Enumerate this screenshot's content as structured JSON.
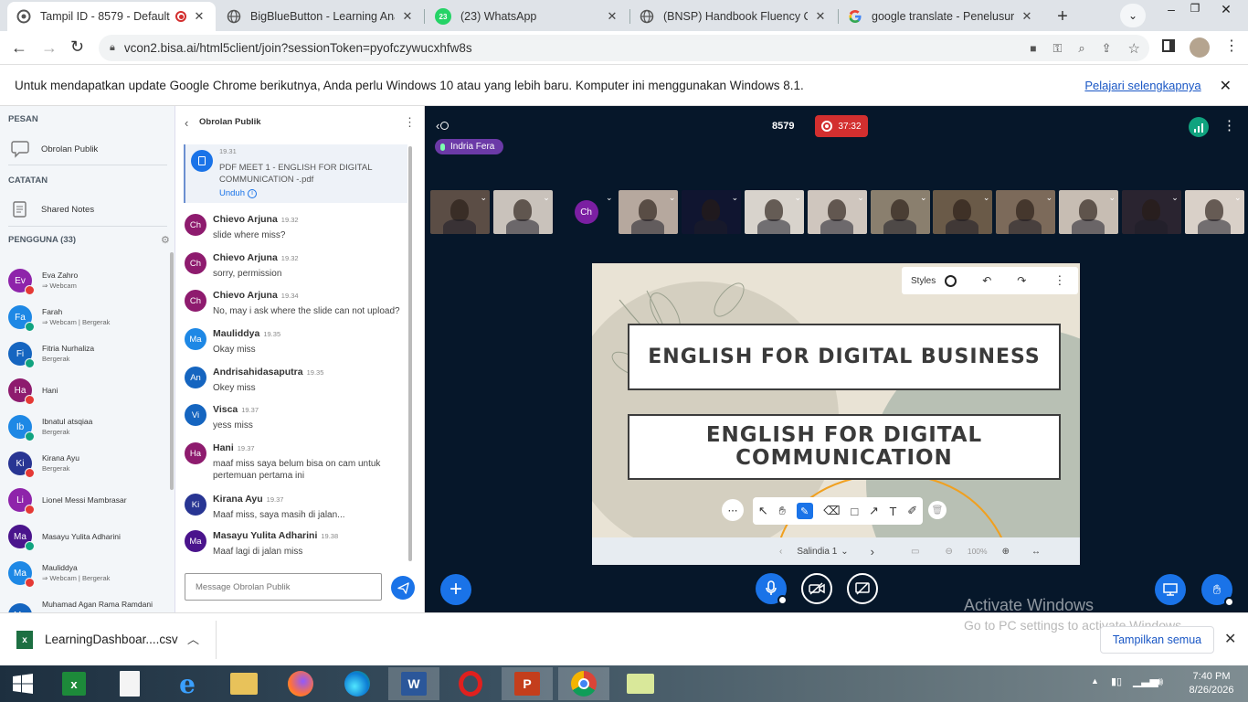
{
  "browser": {
    "tabs": [
      {
        "title": "Tampil ID - 8579 - Default",
        "active": true
      },
      {
        "title": "BigBlueButton - Learning Analy"
      },
      {
        "title": "(23) WhatsApp",
        "badge": "23"
      },
      {
        "title": "(BNSP) Handbook Fluency Clas"
      },
      {
        "title": "google translate - Penelusuran"
      }
    ],
    "url": "vcon2.bisa.ai/html5client/join?sessionToken=pyofczywucxhfw8s",
    "infobar": {
      "message": "Untuk mendapatkan update Google Chrome berikutnya, Anda perlu Windows 10 atau yang lebih baru. Komputer ini menggunakan Windows 8.1.",
      "link": "Pelajari selengkapnya"
    }
  },
  "sidebar": {
    "pesan_header": "PESAN",
    "public_chat": "Obrolan Publik",
    "catatan_header": "CATATAN",
    "shared_notes": "Shared Notes",
    "users_header": "PENGGUNA (33)",
    "users": [
      {
        "initials": "Ev",
        "name": "Eva Zahro",
        "sub": "⇒ Webcam",
        "color": "#8e24aa",
        "status": "red"
      },
      {
        "initials": "Fa",
        "name": "Farah",
        "sub": "⇒ Webcam | Bergerak",
        "color": "#1e88e5",
        "status": "green"
      },
      {
        "initials": "Fi",
        "name": "Fitria Nurhaliza",
        "sub": "Bergerak",
        "color": "#1565c0",
        "status": "green"
      },
      {
        "initials": "Ha",
        "name": "Hani",
        "sub": "",
        "color": "#8e1b6e",
        "status": "red"
      },
      {
        "initials": "Ib",
        "name": "Ibnatul atsqiaa",
        "sub": "Bergerak",
        "color": "#1e88e5",
        "status": "green"
      },
      {
        "initials": "Ki",
        "name": "Kirana Ayu",
        "sub": "Bergerak",
        "color": "#283593",
        "status": "red"
      },
      {
        "initials": "Li",
        "name": "Lionel Messi Mambrasar",
        "sub": "",
        "color": "#8e24aa",
        "status": "red"
      },
      {
        "initials": "Ma",
        "name": "Masayu Yulita Adharini",
        "sub": "",
        "color": "#4a148c",
        "status": "green"
      },
      {
        "initials": "Ma",
        "name": "Mauliddya",
        "sub": "⇒ Webcam | Bergerak",
        "color": "#1e88e5",
        "status": "red"
      },
      {
        "initials": "Mu",
        "name": "Muhamad Agan Rama Ramdani",
        "sub": "",
        "color": "#1565c0",
        "status": ""
      }
    ]
  },
  "chat": {
    "title": "Obrolan Publik",
    "file": {
      "time": "19.31",
      "name": "PDF MEET 1 - ENGLISH FOR DIGITAL COMMUNICATION -.pdf",
      "download": "Unduh"
    },
    "messages": [
      {
        "initials": "Ch",
        "name": "Chievo Arjuna",
        "time": "19.32",
        "text": "slide where miss?",
        "color": "#8e1b6e"
      },
      {
        "initials": "Ch",
        "name": "Chievo Arjuna",
        "time": "19.32",
        "text": "sorry, permission",
        "color": "#8e1b6e"
      },
      {
        "initials": "Ch",
        "name": "Chievo Arjuna",
        "time": "19.34",
        "text": "No, may i ask where the slide can not upload?",
        "color": "#8e1b6e"
      },
      {
        "initials": "Ma",
        "name": "Mauliddya",
        "time": "19.35",
        "text": "Okay miss",
        "color": "#1e88e5"
      },
      {
        "initials": "An",
        "name": "Andrisahidasaputra",
        "time": "19.35",
        "text": "Okey miss",
        "color": "#1565c0"
      },
      {
        "initials": "Vi",
        "name": "Visca",
        "time": "19.37",
        "text": "yess miss",
        "color": "#1565c0"
      },
      {
        "initials": "Ha",
        "name": "Hani",
        "time": "19.37",
        "text": "maaf miss saya belum bisa on cam untuk pertemuan pertama ini",
        "color": "#8e1b6e"
      },
      {
        "initials": "Ki",
        "name": "Kirana Ayu",
        "time": "19.37",
        "text": "Maaf miss, saya masih di jalan...",
        "color": "#283593"
      },
      {
        "initials": "Ma",
        "name": "Masayu Yulita Adharini",
        "time": "19.38",
        "text": "Maaf lagi di jalan miss",
        "color": "#4a148c"
      }
    ],
    "input_placeholder": "Message Obrolan Publik"
  },
  "meeting": {
    "room": "8579",
    "recording_time": "37:32",
    "talker": "Indria Fera",
    "thumbs": [
      {
        "initials": "",
        "tone": "#5b4d45"
      },
      {
        "initials": "",
        "tone": "#c9c2bb"
      },
      {
        "initials": "Ch",
        "tone": "#06172a"
      },
      {
        "initials": "",
        "tone": "#b6a89e"
      },
      {
        "initials": "",
        "tone": "#101530"
      },
      {
        "initials": "",
        "tone": "#d8d3cc"
      },
      {
        "initials": "",
        "tone": "#cfc6be"
      },
      {
        "initials": "",
        "tone": "#8a7f6e"
      },
      {
        "initials": "",
        "tone": "#6a5a48"
      },
      {
        "initials": "",
        "tone": "#7c6a5a"
      },
      {
        "initials": "",
        "tone": "#c7bdb3"
      },
      {
        "initials": "",
        "tone": "#2a2430"
      },
      {
        "initials": "",
        "tone": "#d9d0c8"
      }
    ],
    "slide": {
      "title1": "ENGLISH FOR DIGITAL BUSINESS",
      "title2": "ENGLISH FOR DIGITAL COMMUNICATION",
      "styles_label": "Styles",
      "slide_label": "Salindia 1",
      "zoom": "100%"
    },
    "watermark": {
      "line1": "Activate Windows",
      "line2": "Go to PC settings to activate Windows."
    }
  },
  "downloads": {
    "file": "LearningDashboar....csv",
    "show_all": "Tampilkan semua"
  },
  "taskbar": {
    "time": "7:40 PM",
    "date": "8/26/2026"
  }
}
